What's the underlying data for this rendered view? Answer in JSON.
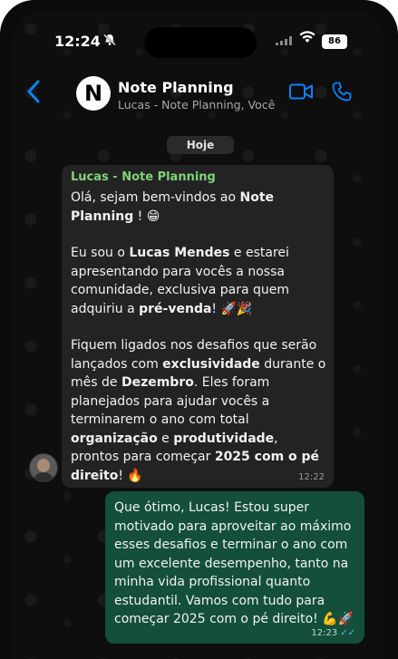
{
  "status": {
    "time": "12:24",
    "battery": "86",
    "silent_icon": "bell-slash-icon",
    "wifi_icon": "wifi-icon",
    "signal_icon": "cellular-signal-icon"
  },
  "header": {
    "back_icon": "chevron-left-icon",
    "logo_letter": "N",
    "title": "Note Planning",
    "subtitle": "Lucas - Note Planning, Você",
    "video_icon": "video-camera-icon",
    "call_icon": "phone-icon",
    "accent": "#0a84ff"
  },
  "date_separator": "Hoje",
  "messages": {
    "incoming": {
      "sender": "Lucas - Note Planning",
      "p1_pre": "Olá, sejam bem-vindos ao ",
      "p1_bold": "Note Planning",
      "p1_post": " ! 😁",
      "p2_a": "Eu sou o ",
      "p2_bold1": "Lucas Mendes",
      "p2_b": " e estarei apresentando para vocês a nossa comunidade, exclusiva para quem adquiriu a ",
      "p2_bold2": "pré-venda",
      "p2_c": "! 🚀🎉",
      "p3_a": "Fiquem ligados nos desafios que serão lançados com ",
      "p3_bold1": "exclusividade",
      "p3_b": " durante o mês de ",
      "p3_bold2": "Dezembro",
      "p3_c": ". Eles foram planejados para ajudar vocês a terminarem o ano com total ",
      "p3_bold3": "organização",
      "p3_d": " e ",
      "p3_bold4": "produtividade",
      "p3_e": ", prontos para começar ",
      "p3_bold5": "2025 com o pé direito",
      "p3_f": "! 🔥",
      "time": "12:22",
      "bubble_color": "#232323",
      "sender_color": "#7fd37a"
    },
    "outgoing": {
      "text": "Que ótimo, Lucas! Estou super motivado para aproveitar ao máximo esses desafios e terminar o ano com um excelente desempenho, tanto na minha vida profissional quanto estudantil. Vamos com tudo para começar 2025 com o pé direito! 💪🚀",
      "time": "12:23",
      "read_icon": "double-check-icon",
      "bubble_color": "#134f3a"
    }
  }
}
